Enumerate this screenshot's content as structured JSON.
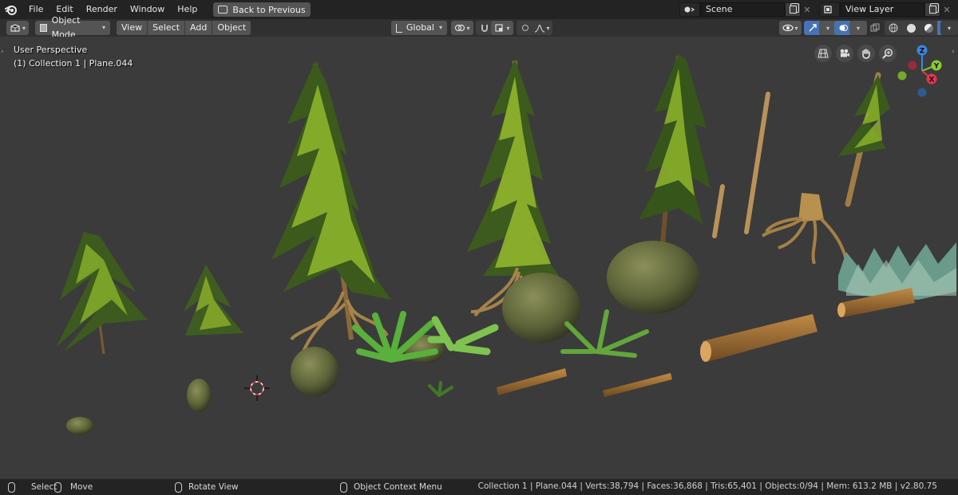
{
  "menu": {
    "items": [
      "File",
      "Edit",
      "Render",
      "Window",
      "Help"
    ],
    "back_label": "Back to Previous"
  },
  "scene": {
    "label": "Scene"
  },
  "view_layer": {
    "label": "View Layer"
  },
  "header": {
    "mode": "Object Mode",
    "menus": [
      "View",
      "Select",
      "Add",
      "Object"
    ],
    "orientation": "Global"
  },
  "viewport": {
    "perspective": "User Perspective",
    "collection_info": "(1) Collection 1 | Plane.044",
    "gizmo": {
      "x": "X",
      "y": "Y",
      "z": "Z"
    }
  },
  "status": {
    "select": "Select",
    "move": "Move",
    "rotate": "Rotate View",
    "context_menu": "Object Context Menu",
    "stats": "Collection 1 | Plane.044 | Verts:38,794 | Faces:36,868 | Tris:65,401 | Objects:0/94 | Mem: 613.2 MB | v2.80.75"
  },
  "colors": {
    "accent": "#4772b3",
    "axis_x": "#e8344c",
    "axis_y": "#8bcc2e",
    "axis_z": "#3b86e0"
  }
}
